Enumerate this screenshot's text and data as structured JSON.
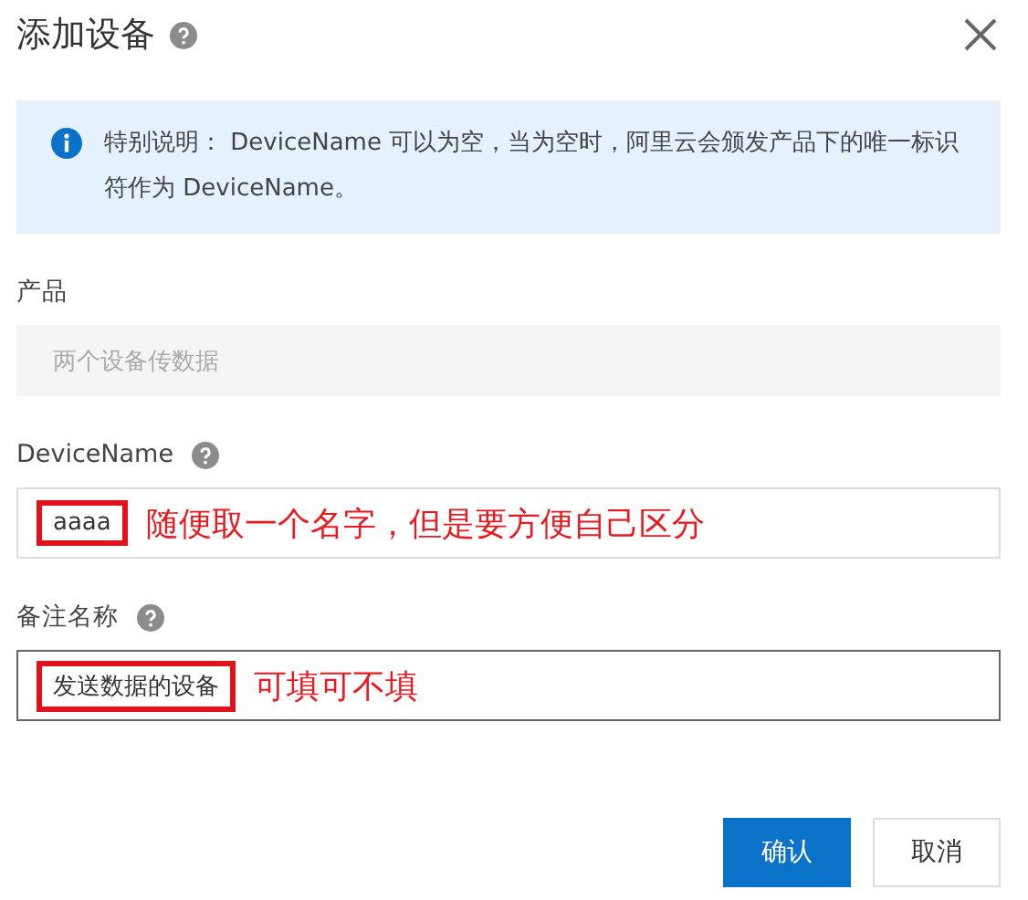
{
  "dialog": {
    "title": "添加设备",
    "title_help": true
  },
  "notice": {
    "text": "特别说明： DeviceName 可以为空，当为空时，阿里云会颁发产品下的唯一标识符作为 DeviceName。"
  },
  "fields": [
    {
      "label": "产品",
      "help": false,
      "value": "两个设备传数据",
      "disabled": true,
      "focused": false,
      "highlighted": false
    },
    {
      "label": "DeviceName",
      "help": true,
      "value": "aaaa",
      "disabled": false,
      "focused": false,
      "highlighted": true,
      "annotation": "随便取一个名字，但是要方便自己区分"
    },
    {
      "label": "备注名称",
      "help": true,
      "value": "发送数据的设备",
      "disabled": false,
      "focused": true,
      "highlighted": true,
      "annotation": "可填可不填"
    }
  ],
  "buttons": [
    {
      "label": "确认",
      "kind": "primary"
    },
    {
      "label": "取消",
      "kind": "default"
    }
  ]
}
